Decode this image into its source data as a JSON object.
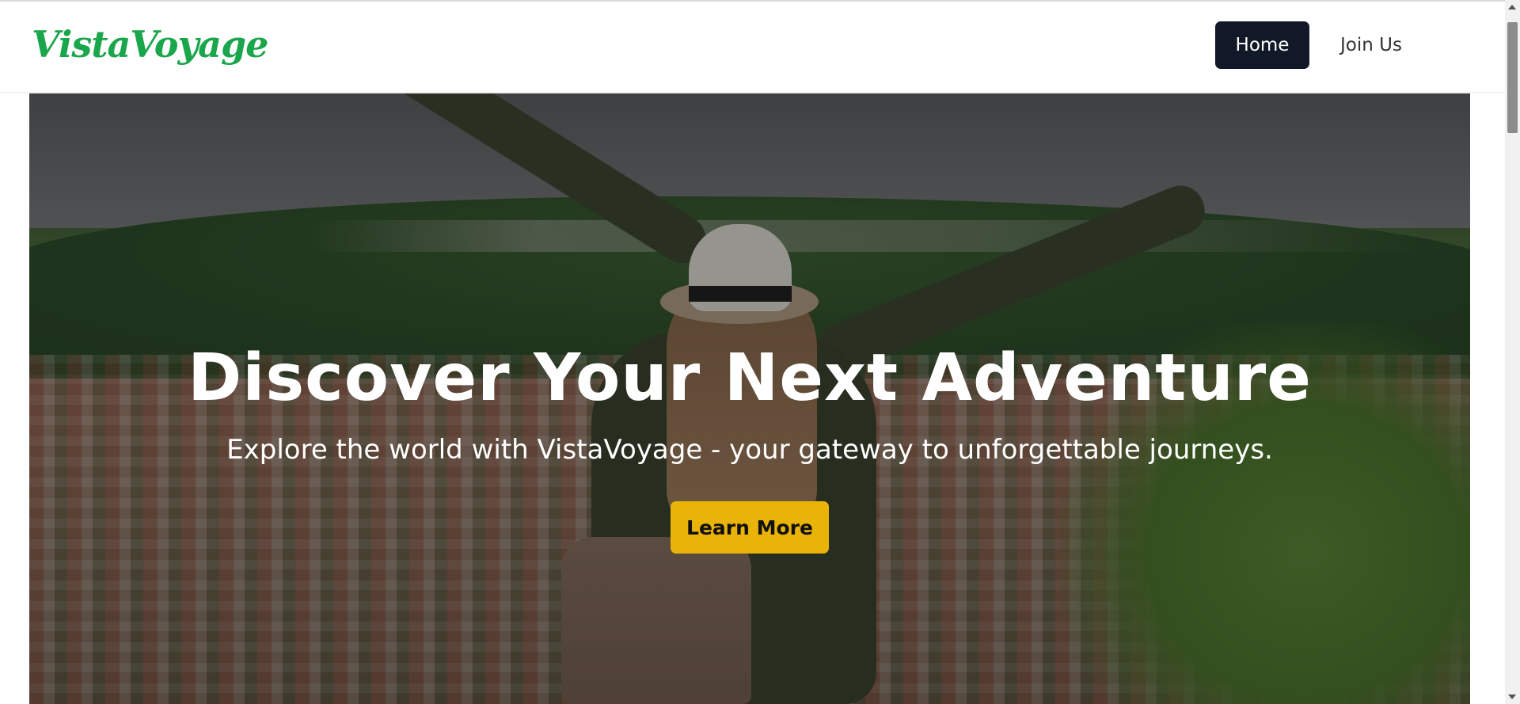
{
  "header": {
    "logo_text": "VistaVoyage",
    "nav": [
      {
        "label": "Home",
        "active": true
      },
      {
        "label": "Join Us",
        "active": false
      }
    ]
  },
  "hero": {
    "title": "Discover Your Next Adventure",
    "subtitle": "Explore the world with VistaVoyage - your gateway to unforgettable journeys.",
    "cta_label": "Learn More",
    "background_image": "traveler-with-raised-arms-overlooking-town"
  },
  "colors": {
    "brand_green": "#1aa64b",
    "nav_active_bg": "#111827",
    "cta_bg": "#eab308",
    "text_white": "#ffffff"
  },
  "icons": {
    "scroll_up": "scroll-up-arrow-icon",
    "scroll_down": "scroll-down-arrow-icon"
  }
}
